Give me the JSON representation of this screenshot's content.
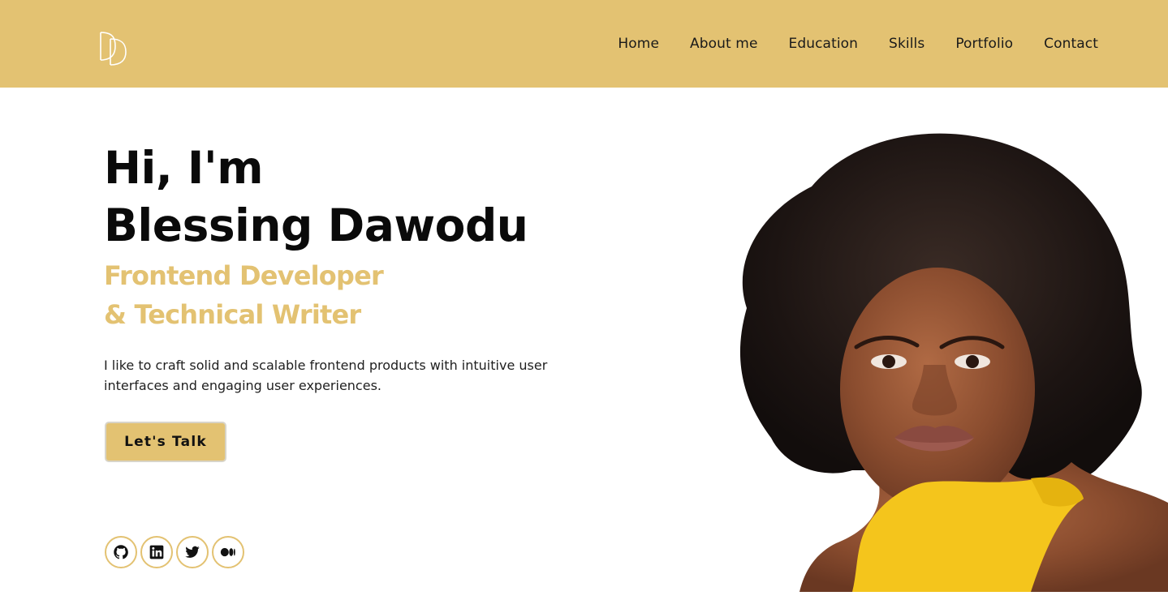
{
  "header": {
    "logo_initials": "DD",
    "nav": {
      "home": "Home",
      "about": "About me",
      "education": "Education",
      "skills": "Skills",
      "portfolio": "Portfolio",
      "contact": "Contact"
    }
  },
  "hero": {
    "greeting": "Hi, I'm",
    "name": "Blessing Dawodu",
    "role_line1": "Frontend Developer",
    "role_line2": "& Technical Writer",
    "description": "I like to craft solid and scalable frontend products with intuitive user interfaces and engaging user experiences.",
    "cta_label": "Let's Talk"
  },
  "socials": [
    {
      "icon": "github-icon"
    },
    {
      "icon": "linkedin-icon"
    },
    {
      "icon": "twitter-icon"
    },
    {
      "icon": "medium-icon"
    }
  ],
  "colors": {
    "accent": "#e3c272",
    "text": "#0a0a0a",
    "background": "#ffffff"
  }
}
